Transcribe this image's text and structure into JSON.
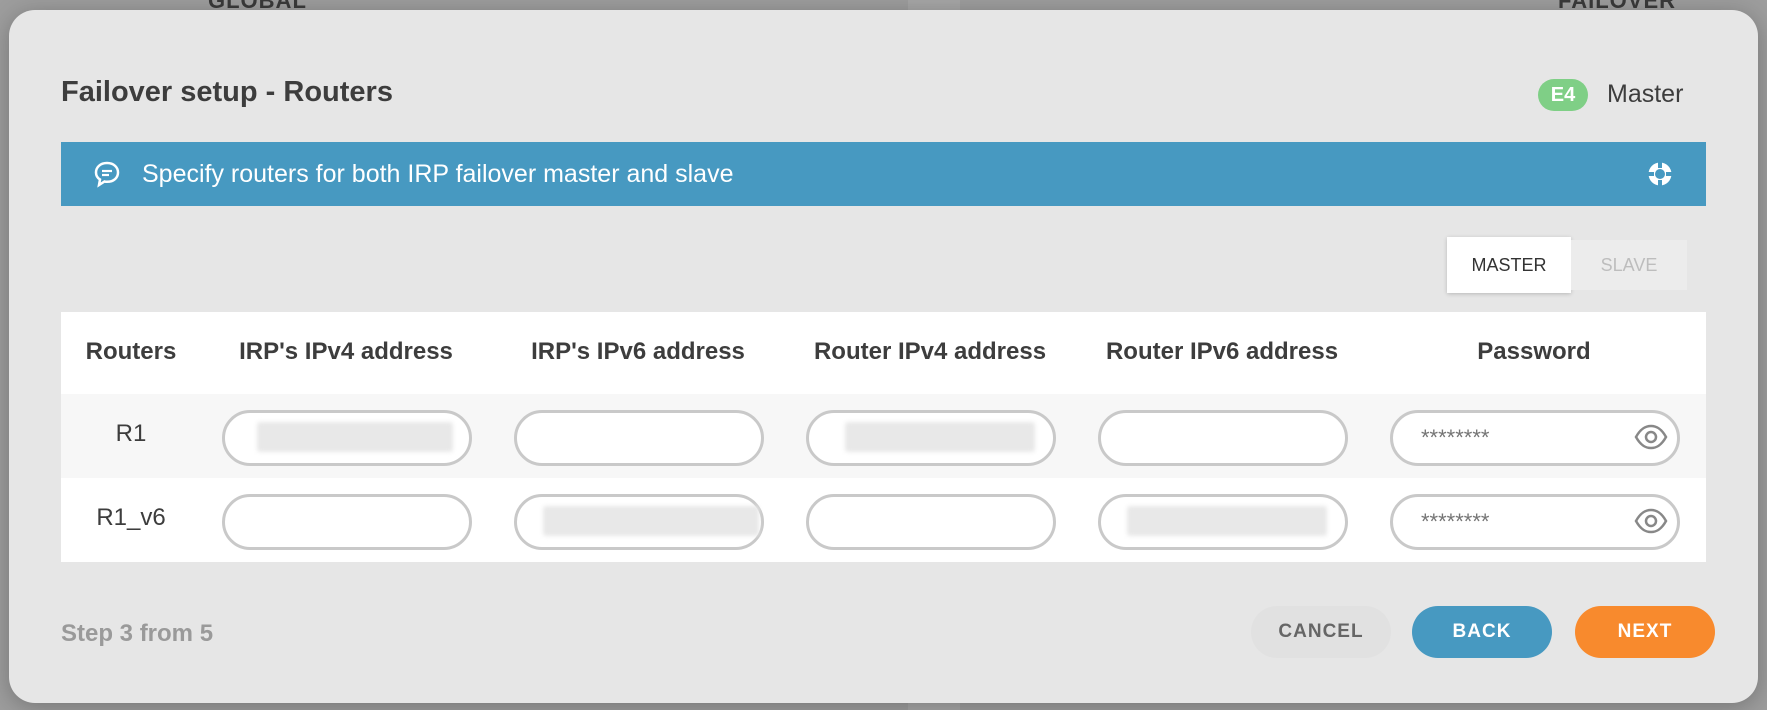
{
  "background": {
    "label_left": "GLOBAL",
    "label_right": "FAILOVER"
  },
  "dialog": {
    "title": "Failover setup - Routers",
    "mode_badge": "E4",
    "mode_label": "Master",
    "info_text": "Specify routers for both IRP failover master and slave",
    "segment": {
      "master": "MASTER",
      "slave": "SLAVE",
      "active": "MASTER"
    },
    "table": {
      "headers": [
        "Routers",
        "IRP's IPv4 address",
        "IRP's IPv6 address",
        "Router IPv4 address",
        "Router IPv6 address",
        "Password"
      ],
      "rows": [
        {
          "name": "R1",
          "password_placeholder": "********"
        },
        {
          "name": "R1_v6",
          "password_placeholder": "********"
        }
      ]
    },
    "step_text": "Step 3 from 5",
    "buttons": {
      "cancel": "CANCEL",
      "back": "BACK",
      "next": "NEXT"
    }
  },
  "colors": {
    "banner": "#4799c1",
    "badge": "#7fcf86",
    "back": "#4799c1",
    "next": "#f88a2d"
  }
}
